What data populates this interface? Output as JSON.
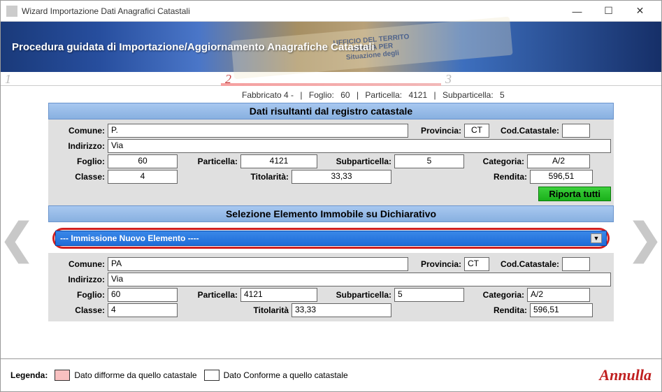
{
  "window": {
    "title": "Wizard Importazione Dati Anagrafici Catastali"
  },
  "banner": {
    "title": "Procedura guidata di Importazione/Aggiornamento Anagrafiche Catastali",
    "doc_line1": "UFFICIO DEL TERRITO",
    "doc_line2": "VISURA PER",
    "doc_line3": "Situazione degli"
  },
  "steps": {
    "s1": "1",
    "s2": "2",
    "s3": "3"
  },
  "breadcrumb": {
    "item_label": "Fabbricato 4 -",
    "foglio_label": "Foglio:",
    "foglio": "60",
    "particella_label": "Particella:",
    "particella": "4121",
    "subparticella_label": "Subparticella:",
    "subparticella": "5"
  },
  "section1": {
    "header": "Dati risultanti dal registro catastale",
    "comune_label": "Comune:",
    "comune": "P.",
    "provincia_label": "Provincia:",
    "provincia": "CT",
    "codcat_label": "Cod.Catastale:",
    "codcat": "",
    "indirizzo_label": "Indirizzo:",
    "indirizzo": "Via",
    "foglio_label": "Foglio:",
    "foglio": "60",
    "particella_label": "Particella:",
    "particella": "4121",
    "subparticella_label": "Subparticella:",
    "subparticella": "5",
    "categoria_label": "Categoria:",
    "categoria": "A/2",
    "classe_label": "Classe:",
    "classe": "4",
    "titolarita_label": "Titolarità:",
    "titolarita": "33,33",
    "rendita_label": "Rendita:",
    "rendita": "596,51",
    "riporta_btn": "Riporta tutti"
  },
  "section2": {
    "header": "Selezione Elemento Immobile su Dichiarativo",
    "combo_text": "---   Immissione Nuovo Elemento   ----",
    "comune_label": "Comune:",
    "comune": "PA",
    "provincia_label": "Provincia:",
    "provincia": "CT",
    "codcat_label": "Cod.Catastale:",
    "codcat": "",
    "indirizzo_label": "Indirizzo:",
    "indirizzo": "Via",
    "foglio_label": "Foglio:",
    "foglio": "60",
    "particella_label": "Particella:",
    "particella": "4121",
    "subparticella_label": "Subparticella:",
    "subparticella": "5",
    "categoria_label": "Categoria:",
    "categoria": "A/2",
    "classe_label": "Classe:",
    "classe": "4",
    "titolarita_label": "Titolarità",
    "titolarita": "33,33",
    "rendita_label": "Rendita:",
    "rendita": "596,51"
  },
  "legend": {
    "label": "Legenda:",
    "difforme": "Dato difforme da quello catastale",
    "conforme": "Dato Conforme a quello catastale",
    "annulla": "Annulla"
  }
}
